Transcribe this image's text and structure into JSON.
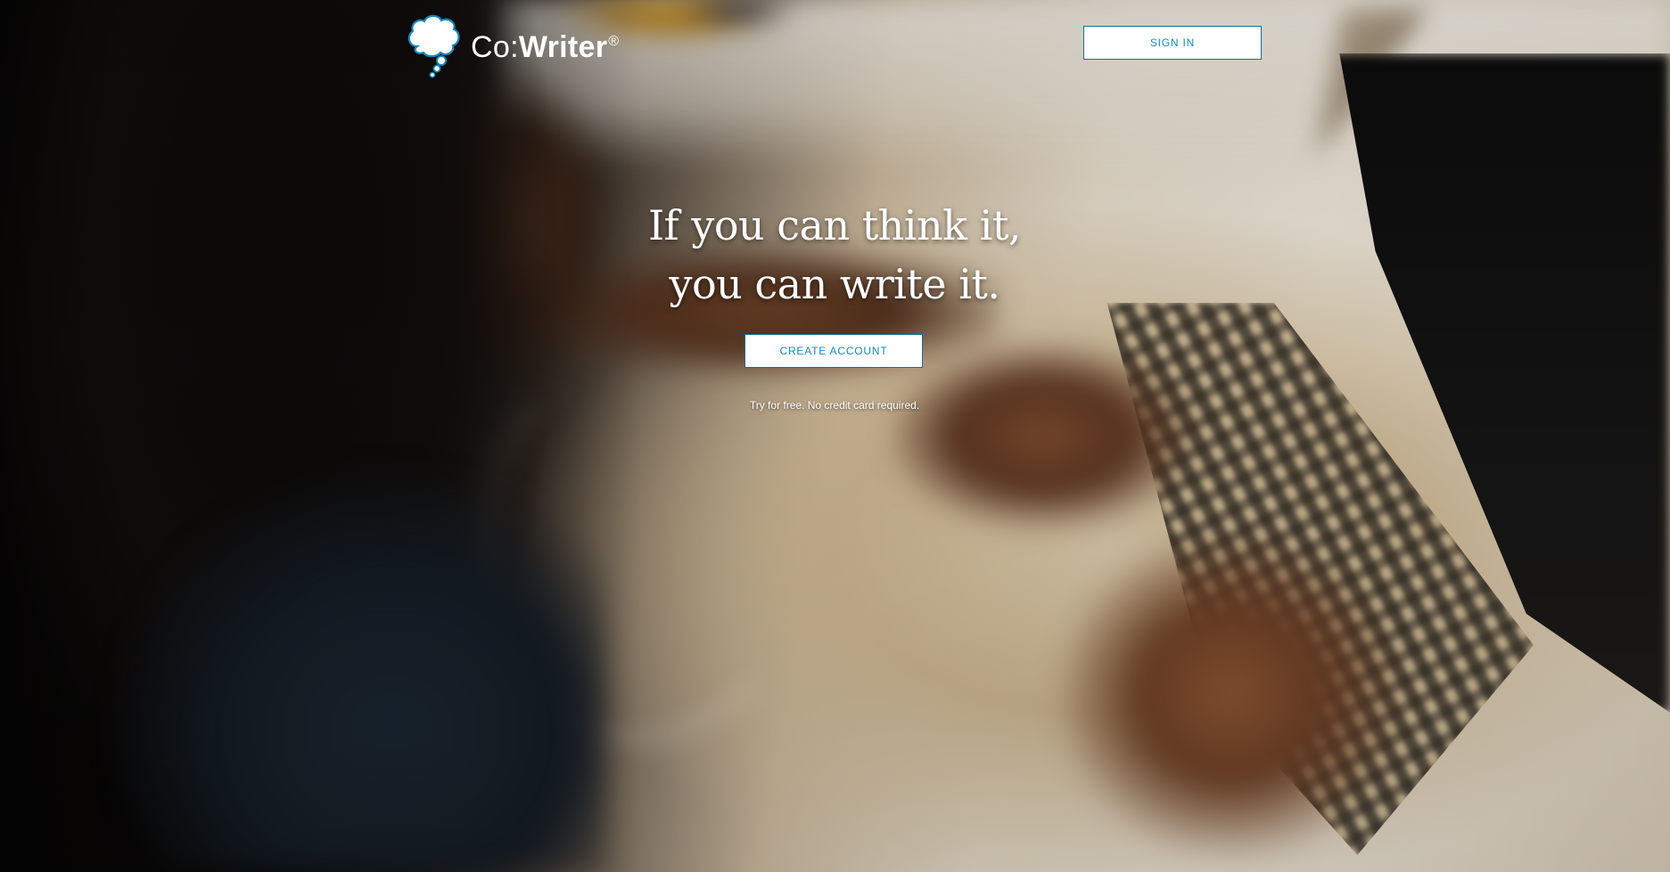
{
  "header": {
    "logo": {
      "brand_prefix": "Co:",
      "brand_name": "Writer",
      "registered_mark": "®",
      "icon": "thought-bubble-icon"
    },
    "sign_in_label": "SIGN IN"
  },
  "hero": {
    "headline_line1": "If you can think it,",
    "headline_line2": "you can write it.",
    "cta_label": "CREATE ACCOUNT",
    "tagline": "Try for free. No credit card required."
  },
  "colors": {
    "accent": "#1b87b8",
    "button_border": "#1c6e8c",
    "button_bg": "#ffffff",
    "text_on_photo": "#ffffff"
  }
}
